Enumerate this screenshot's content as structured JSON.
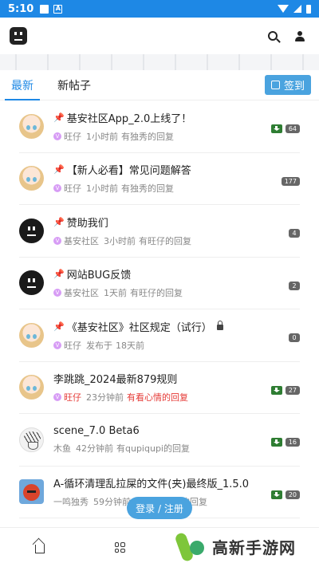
{
  "status_bar": {
    "time": "5:10"
  },
  "tabs": [
    {
      "label": "最新",
      "active": true
    },
    {
      "label": "新帖子",
      "active": false
    }
  ],
  "signin_label": "签到",
  "posts": [
    {
      "avatar": "anime",
      "pinned": true,
      "title": "基安社区App_2.0上线了！",
      "author": "旺仔",
      "author_red": false,
      "time": "1小时前",
      "reply": "有独秀的回复",
      "reply_red": false,
      "download": true,
      "count": "64",
      "locked": false
    },
    {
      "avatar": "anime",
      "pinned": true,
      "title": "【新人必看】常见问题解答",
      "author": "旺仔",
      "author_red": false,
      "time": "1小时前",
      "reply": "有独秀的回复",
      "reply_red": false,
      "download": false,
      "count": "177",
      "locked": false
    },
    {
      "avatar": "black",
      "pinned": true,
      "title": "赞助我们",
      "author": "基安社区",
      "author_red": false,
      "time": "3小时前",
      "reply": "有旺仔的回复",
      "reply_red": false,
      "download": false,
      "count": "4",
      "locked": false
    },
    {
      "avatar": "black",
      "pinned": true,
      "title": "网站BUG反馈",
      "author": "基安社区",
      "author_red": false,
      "time": "1天前",
      "reply": "有旺仔的回复",
      "reply_red": false,
      "download": false,
      "count": "2",
      "locked": false
    },
    {
      "avatar": "anime",
      "pinned": true,
      "title": "《基安社区》社区规定（试行）",
      "author": "旺仔",
      "author_red": false,
      "time": "发布于",
      "reply": "18天前",
      "reply_red": false,
      "download": false,
      "count": "0",
      "locked": true
    },
    {
      "avatar": "anime",
      "pinned": false,
      "title": "李跳跳_2024最新879规则",
      "author": "旺仔",
      "author_red": true,
      "time": "23分钟前",
      "reply": "有看心情的回复",
      "reply_red": true,
      "download": true,
      "count": "27",
      "locked": false
    },
    {
      "avatar": "sketch",
      "pinned": false,
      "title": "scene_7.0 Beta6",
      "author": "木鱼",
      "author_red": false,
      "time": "42分钟前",
      "reply": "有qupiqupi的回复",
      "reply_red": false,
      "download": true,
      "count": "16",
      "locked": false
    },
    {
      "avatar": "cat",
      "pinned": false,
      "title": "A-循环清理乱拉屎的文件(夹)最终版_1.5.0",
      "author": "一鸣独秀",
      "author_red": false,
      "time": "59分钟前",
      "reply": "有qupiqupi的回复",
      "reply_red": false,
      "download": true,
      "count": "20",
      "locked": false
    }
  ],
  "login_label": "登录 / 注册",
  "watermark_text": "高新手游网",
  "icons": {
    "search": "search-icon",
    "user": "user-icon",
    "home": "home-icon",
    "grid": "grid-icon",
    "pin": "pin-icon",
    "lock": "lock-icon",
    "download": "download-icon"
  },
  "colors": {
    "accent": "#1e88e5",
    "button": "#4aa3df",
    "pin": "#e53935",
    "download": "#2e7d32"
  }
}
